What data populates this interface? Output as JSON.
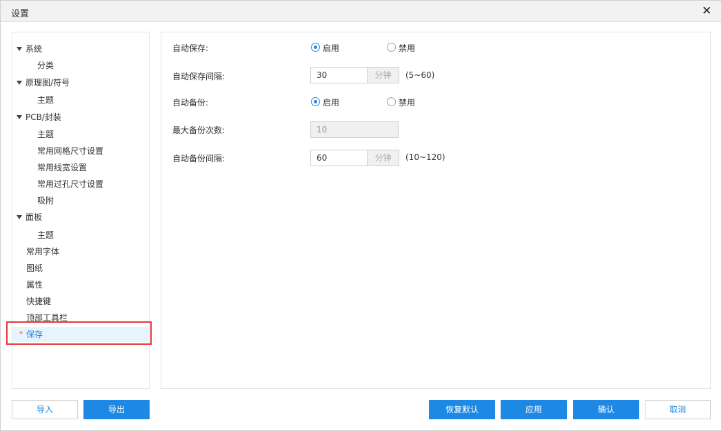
{
  "window": {
    "title": "设置",
    "close_glyph": "✕"
  },
  "tree": {
    "items": [
      {
        "label": "系统",
        "level": 0,
        "expandable": true
      },
      {
        "label": "分类",
        "level": 1
      },
      {
        "label": "原理图/符号",
        "level": 0,
        "expandable": true
      },
      {
        "label": "主题",
        "level": 1
      },
      {
        "label": "PCB/封装",
        "level": 0,
        "expandable": true
      },
      {
        "label": "主题",
        "level": 1
      },
      {
        "label": "常用网格尺寸设置",
        "level": 1
      },
      {
        "label": "常用线宽设置",
        "level": 1
      },
      {
        "label": "常用过孔尺寸设置",
        "level": 1
      },
      {
        "label": "吸附",
        "level": 1
      },
      {
        "label": "面板",
        "level": 0,
        "expandable": true
      },
      {
        "label": "主题",
        "level": 1
      },
      {
        "label": "常用字体",
        "level": 0
      },
      {
        "label": "图纸",
        "level": 0
      },
      {
        "label": "属性",
        "level": 0
      },
      {
        "label": "快捷键",
        "level": 0
      },
      {
        "label": "顶部工具栏",
        "level": 0
      },
      {
        "label": "保存",
        "level": 0,
        "selected": true,
        "marker": "*"
      }
    ]
  },
  "form": {
    "auto_save": {
      "label": "自动保存:",
      "enable": "启用",
      "disable": "禁用",
      "value": "enable"
    },
    "auto_save_interval": {
      "label": "自动保存间隔:",
      "value": "30",
      "unit": "分钟",
      "range": "(5~60)"
    },
    "auto_backup": {
      "label": "自动备份:",
      "enable": "启用",
      "disable": "禁用",
      "value": "enable"
    },
    "max_backups": {
      "label": "最大备份次数:",
      "value": "10",
      "disabled": true
    },
    "auto_backup_interval": {
      "label": "自动备份间隔:",
      "value": "60",
      "unit": "分钟",
      "range": "(10~120)"
    }
  },
  "buttons": {
    "import": "导入",
    "export": "导出",
    "restore_defaults": "恢复默认",
    "apply": "应用",
    "confirm": "确认",
    "cancel": "取消"
  },
  "colors": {
    "accent": "#1e88e5",
    "highlight": "#e53935",
    "selected_bg": "#e8f4fd"
  }
}
